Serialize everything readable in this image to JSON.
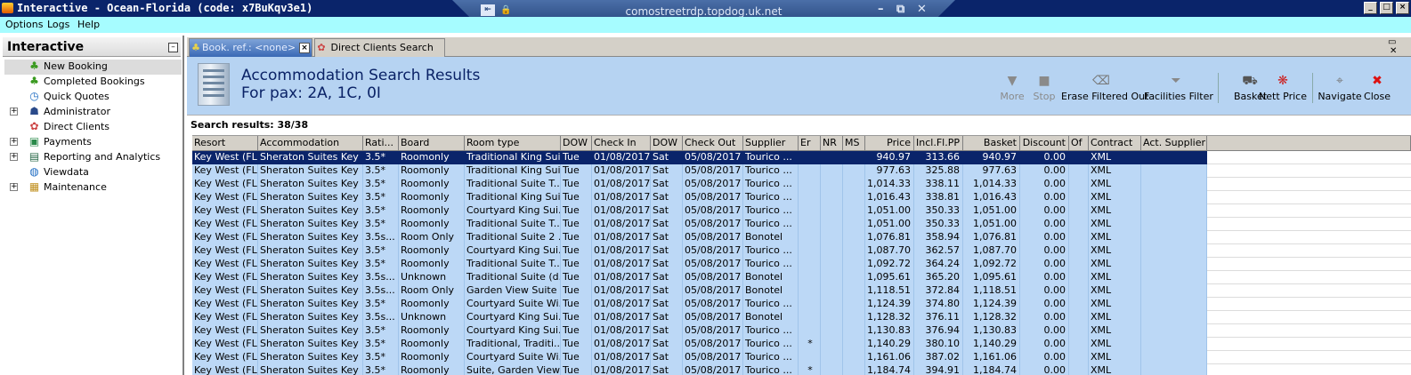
{
  "window": {
    "title": "Interactive - Ocean-Florida (code: x7BuKqv3e1)"
  },
  "rdp": {
    "host": "comostreetrdp.topdog.uk.net"
  },
  "menu": {
    "items": [
      "Options",
      "Logs",
      "Help"
    ]
  },
  "nav": {
    "title": "Interactive",
    "items": [
      {
        "label": "New Booking",
        "icon": "palm-tree-icon",
        "expandable": false,
        "selected": true
      },
      {
        "label": "Completed Bookings",
        "icon": "palm-tree-icon",
        "expandable": false,
        "selected": false
      },
      {
        "label": "Quick Quotes",
        "icon": "clock-icon",
        "expandable": false,
        "selected": false
      },
      {
        "label": "Administrator",
        "icon": "person-icon",
        "expandable": true,
        "selected": false
      },
      {
        "label": "Direct Clients",
        "icon": "client-icon",
        "expandable": false,
        "selected": false
      },
      {
        "label": "Payments",
        "icon": "payment-icon",
        "expandable": true,
        "selected": false
      },
      {
        "label": "Reporting and Analytics",
        "icon": "report-icon",
        "expandable": true,
        "selected": false
      },
      {
        "label": "Viewdata",
        "icon": "globe-icon",
        "expandable": false,
        "selected": false
      },
      {
        "label": "Maintenance",
        "icon": "tools-icon",
        "expandable": true,
        "selected": false
      }
    ]
  },
  "tabs": [
    {
      "label": "Book. ref.: <none>",
      "active": true
    },
    {
      "label": "Direct Clients Search",
      "active": false
    }
  ],
  "header": {
    "title": "Accommodation Search Results",
    "subtitle": "For pax: 2A, 1C, 0I"
  },
  "toolbar": {
    "buttons": [
      {
        "label": "More",
        "icon": "arrow-down-icon",
        "enabled": false
      },
      {
        "label": "Stop",
        "icon": "stop-icon",
        "enabled": false
      },
      {
        "label": "Erase Filtered Out",
        "icon": "erase-icon",
        "enabled": true
      },
      {
        "label": "Facilities Filter",
        "icon": "filter-icon",
        "enabled": true
      },
      {
        "label": "Basket",
        "icon": "basket-icon",
        "enabled": true
      },
      {
        "label": "Nett Price",
        "icon": "nett-price-icon",
        "enabled": true
      },
      {
        "label": "Navigate",
        "icon": "navigate-icon",
        "enabled": true
      },
      {
        "label": "Close",
        "icon": "close-icon",
        "enabled": true
      }
    ]
  },
  "results": {
    "count_label": "Search results: 38/38",
    "columns": [
      "Resort",
      "Accommodation",
      "Rati...",
      "Board",
      "Room type",
      "DOW",
      "Check In",
      "DOW",
      "Check Out",
      "Supplier",
      "Er",
      "NR",
      "MS",
      "Price",
      "Incl.Fl.PP",
      "Basket",
      "Discount",
      "Of",
      "Contract",
      "Act. Supplier"
    ],
    "rows": [
      [
        "Key West (FL)",
        "Sheraton Suites Key ...",
        "3.5*",
        "Roomonly",
        "Traditional King Sui...",
        "Tue",
        "01/08/2017",
        "Sat",
        "05/08/2017",
        "Tourico ...",
        "",
        "",
        "",
        "940.97",
        "313.66",
        "940.97",
        "0.00",
        "",
        "XML",
        ""
      ],
      [
        "Key West (FL)",
        "Sheraton Suites Key ...",
        "3.5*",
        "Roomonly",
        "Traditional King Sui...",
        "Tue",
        "01/08/2017",
        "Sat",
        "05/08/2017",
        "Tourico ...",
        "",
        "",
        "",
        "977.63",
        "325.88",
        "977.63",
        "0.00",
        "",
        "XML",
        ""
      ],
      [
        "Key West (FL)",
        "Sheraton Suites Key ...",
        "3.5*",
        "Roomonly",
        "Traditional Suite T...",
        "Tue",
        "01/08/2017",
        "Sat",
        "05/08/2017",
        "Tourico ...",
        "",
        "",
        "",
        "1,014.33",
        "338.11",
        "1,014.33",
        "0.00",
        "",
        "XML",
        ""
      ],
      [
        "Key West (FL)",
        "Sheraton Suites Key ...",
        "3.5*",
        "Roomonly",
        "Traditional King Sui...",
        "Tue",
        "01/08/2017",
        "Sat",
        "05/08/2017",
        "Tourico ...",
        "",
        "",
        "",
        "1,016.43",
        "338.81",
        "1,016.43",
        "0.00",
        "",
        "XML",
        ""
      ],
      [
        "Key West (FL)",
        "Sheraton Suites Key ...",
        "3.5*",
        "Roomonly",
        "Courtyard King Sui...",
        "Tue",
        "01/08/2017",
        "Sat",
        "05/08/2017",
        "Tourico ...",
        "",
        "",
        "",
        "1,051.00",
        "350.33",
        "1,051.00",
        "0.00",
        "",
        "XML",
        ""
      ],
      [
        "Key West (FL)",
        "Sheraton Suites Key ...",
        "3.5*",
        "Roomonly",
        "Traditional Suite T...",
        "Tue",
        "01/08/2017",
        "Sat",
        "05/08/2017",
        "Tourico ...",
        "",
        "",
        "",
        "1,051.00",
        "350.33",
        "1,051.00",
        "0.00",
        "",
        "XML",
        ""
      ],
      [
        "Key West (FL)",
        "Sheraton Suites Key ...",
        "3.5s...",
        "Room Only",
        "Traditional Suite 2 ...",
        "Tue",
        "01/08/2017",
        "Sat",
        "05/08/2017",
        "Bonotel",
        "",
        "",
        "",
        "1,076.81",
        "358.94",
        "1,076.81",
        "0.00",
        "",
        "XML",
        ""
      ],
      [
        "Key West (FL)",
        "Sheraton Suites Key ...",
        "3.5*",
        "Roomonly",
        "Courtyard King Sui...",
        "Tue",
        "01/08/2017",
        "Sat",
        "05/08/2017",
        "Tourico ...",
        "",
        "",
        "",
        "1,087.70",
        "362.57",
        "1,087.70",
        "0.00",
        "",
        "XML",
        ""
      ],
      [
        "Key West (FL)",
        "Sheraton Suites Key ...",
        "3.5*",
        "Roomonly",
        "Traditional Suite T...",
        "Tue",
        "01/08/2017",
        "Sat",
        "05/08/2017",
        "Tourico ...",
        "",
        "",
        "",
        "1,092.72",
        "364.24",
        "1,092.72",
        "0.00",
        "",
        "XML",
        ""
      ],
      [
        "Key West (FL)",
        "Sheraton Suites Key ...",
        "3.5s...",
        "Unknown",
        "Traditional Suite (d...",
        "Tue",
        "01/08/2017",
        "Sat",
        "05/08/2017",
        "Bonotel",
        "",
        "",
        "",
        "1,095.61",
        "365.20",
        "1,095.61",
        "0.00",
        "",
        "XML",
        ""
      ],
      [
        "Key West (FL)",
        "Sheraton Suites Key ...",
        "3.5s...",
        "Room Only",
        "Garden View Suite ...",
        "Tue",
        "01/08/2017",
        "Sat",
        "05/08/2017",
        "Bonotel",
        "",
        "",
        "",
        "1,118.51",
        "372.84",
        "1,118.51",
        "0.00",
        "",
        "XML",
        ""
      ],
      [
        "Key West (FL)",
        "Sheraton Suites Key ...",
        "3.5*",
        "Roomonly",
        "Courtyard Suite Wi...",
        "Tue",
        "01/08/2017",
        "Sat",
        "05/08/2017",
        "Tourico ...",
        "",
        "",
        "",
        "1,124.39",
        "374.80",
        "1,124.39",
        "0.00",
        "",
        "XML",
        ""
      ],
      [
        "Key West (FL)",
        "Sheraton Suites Key ...",
        "3.5s...",
        "Unknown",
        "Courtyard King Sui...",
        "Tue",
        "01/08/2017",
        "Sat",
        "05/08/2017",
        "Bonotel",
        "",
        "",
        "",
        "1,128.32",
        "376.11",
        "1,128.32",
        "0.00",
        "",
        "XML",
        ""
      ],
      [
        "Key West (FL)",
        "Sheraton Suites Key ...",
        "3.5*",
        "Roomonly",
        "Courtyard King Sui...",
        "Tue",
        "01/08/2017",
        "Sat",
        "05/08/2017",
        "Tourico ...",
        "",
        "",
        "",
        "1,130.83",
        "376.94",
        "1,130.83",
        "0.00",
        "",
        "XML",
        ""
      ],
      [
        "Key West (FL)",
        "Sheraton Suites Key ...",
        "3.5*",
        "Roomonly",
        "Traditional, Traditi...",
        "Tue",
        "01/08/2017",
        "Sat",
        "05/08/2017",
        "Tourico ...",
        "*",
        "",
        "",
        "1,140.29",
        "380.10",
        "1,140.29",
        "0.00",
        "",
        "XML",
        ""
      ],
      [
        "Key West (FL)",
        "Sheraton Suites Key ...",
        "3.5*",
        "Roomonly",
        "Courtyard Suite Wi...",
        "Tue",
        "01/08/2017",
        "Sat",
        "05/08/2017",
        "Tourico ...",
        "",
        "",
        "",
        "1,161.06",
        "387.02",
        "1,161.06",
        "0.00",
        "",
        "XML",
        ""
      ],
      [
        "Key West (FL)",
        "Sheraton Suites Key ...",
        "3.5*",
        "Roomonly",
        "Suite, Garden View...",
        "Tue",
        "01/08/2017",
        "Sat",
        "05/08/2017",
        "Tourico ...",
        "*",
        "",
        "",
        "1,184.74",
        "394.91",
        "1,184.74",
        "0.00",
        "",
        "XML",
        ""
      ]
    ]
  },
  "colors": {
    "title_bar": "#0a246a",
    "menu_bar": "#a6fcff",
    "header": "#b6d3f2",
    "row": "#bcd8f6",
    "selected_row": "#0a246a"
  }
}
